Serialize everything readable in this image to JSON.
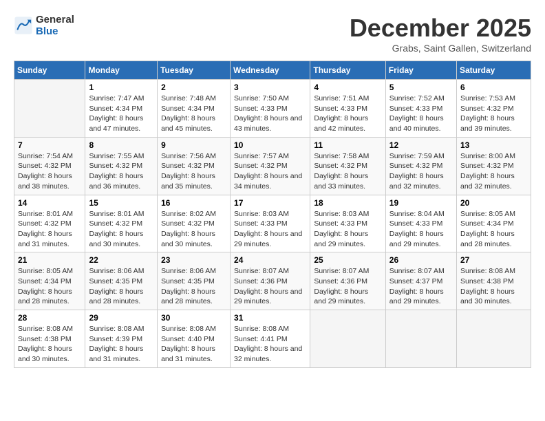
{
  "logo": {
    "line1": "General",
    "line2": "Blue"
  },
  "title": "December 2025",
  "subtitle": "Grabs, Saint Gallen, Switzerland",
  "days_of_week": [
    "Sunday",
    "Monday",
    "Tuesday",
    "Wednesday",
    "Thursday",
    "Friday",
    "Saturday"
  ],
  "weeks": [
    [
      {
        "day": "",
        "sunrise": "",
        "sunset": "",
        "daylight": ""
      },
      {
        "day": "1",
        "sunrise": "Sunrise: 7:47 AM",
        "sunset": "Sunset: 4:34 PM",
        "daylight": "Daylight: 8 hours and 47 minutes."
      },
      {
        "day": "2",
        "sunrise": "Sunrise: 7:48 AM",
        "sunset": "Sunset: 4:34 PM",
        "daylight": "Daylight: 8 hours and 45 minutes."
      },
      {
        "day": "3",
        "sunrise": "Sunrise: 7:50 AM",
        "sunset": "Sunset: 4:33 PM",
        "daylight": "Daylight: 8 hours and 43 minutes."
      },
      {
        "day": "4",
        "sunrise": "Sunrise: 7:51 AM",
        "sunset": "Sunset: 4:33 PM",
        "daylight": "Daylight: 8 hours and 42 minutes."
      },
      {
        "day": "5",
        "sunrise": "Sunrise: 7:52 AM",
        "sunset": "Sunset: 4:33 PM",
        "daylight": "Daylight: 8 hours and 40 minutes."
      },
      {
        "day": "6",
        "sunrise": "Sunrise: 7:53 AM",
        "sunset": "Sunset: 4:32 PM",
        "daylight": "Daylight: 8 hours and 39 minutes."
      }
    ],
    [
      {
        "day": "7",
        "sunrise": "Sunrise: 7:54 AM",
        "sunset": "Sunset: 4:32 PM",
        "daylight": "Daylight: 8 hours and 38 minutes."
      },
      {
        "day": "8",
        "sunrise": "Sunrise: 7:55 AM",
        "sunset": "Sunset: 4:32 PM",
        "daylight": "Daylight: 8 hours and 36 minutes."
      },
      {
        "day": "9",
        "sunrise": "Sunrise: 7:56 AM",
        "sunset": "Sunset: 4:32 PM",
        "daylight": "Daylight: 8 hours and 35 minutes."
      },
      {
        "day": "10",
        "sunrise": "Sunrise: 7:57 AM",
        "sunset": "Sunset: 4:32 PM",
        "daylight": "Daylight: 8 hours and 34 minutes."
      },
      {
        "day": "11",
        "sunrise": "Sunrise: 7:58 AM",
        "sunset": "Sunset: 4:32 PM",
        "daylight": "Daylight: 8 hours and 33 minutes."
      },
      {
        "day": "12",
        "sunrise": "Sunrise: 7:59 AM",
        "sunset": "Sunset: 4:32 PM",
        "daylight": "Daylight: 8 hours and 32 minutes."
      },
      {
        "day": "13",
        "sunrise": "Sunrise: 8:00 AM",
        "sunset": "Sunset: 4:32 PM",
        "daylight": "Daylight: 8 hours and 32 minutes."
      }
    ],
    [
      {
        "day": "14",
        "sunrise": "Sunrise: 8:01 AM",
        "sunset": "Sunset: 4:32 PM",
        "daylight": "Daylight: 8 hours and 31 minutes."
      },
      {
        "day": "15",
        "sunrise": "Sunrise: 8:01 AM",
        "sunset": "Sunset: 4:32 PM",
        "daylight": "Daylight: 8 hours and 30 minutes."
      },
      {
        "day": "16",
        "sunrise": "Sunrise: 8:02 AM",
        "sunset": "Sunset: 4:32 PM",
        "daylight": "Daylight: 8 hours and 30 minutes."
      },
      {
        "day": "17",
        "sunrise": "Sunrise: 8:03 AM",
        "sunset": "Sunset: 4:33 PM",
        "daylight": "Daylight: 8 hours and 29 minutes."
      },
      {
        "day": "18",
        "sunrise": "Sunrise: 8:03 AM",
        "sunset": "Sunset: 4:33 PM",
        "daylight": "Daylight: 8 hours and 29 minutes."
      },
      {
        "day": "19",
        "sunrise": "Sunrise: 8:04 AM",
        "sunset": "Sunset: 4:33 PM",
        "daylight": "Daylight: 8 hours and 29 minutes."
      },
      {
        "day": "20",
        "sunrise": "Sunrise: 8:05 AM",
        "sunset": "Sunset: 4:34 PM",
        "daylight": "Daylight: 8 hours and 28 minutes."
      }
    ],
    [
      {
        "day": "21",
        "sunrise": "Sunrise: 8:05 AM",
        "sunset": "Sunset: 4:34 PM",
        "daylight": "Daylight: 8 hours and 28 minutes."
      },
      {
        "day": "22",
        "sunrise": "Sunrise: 8:06 AM",
        "sunset": "Sunset: 4:35 PM",
        "daylight": "Daylight: 8 hours and 28 minutes."
      },
      {
        "day": "23",
        "sunrise": "Sunrise: 8:06 AM",
        "sunset": "Sunset: 4:35 PM",
        "daylight": "Daylight: 8 hours and 28 minutes."
      },
      {
        "day": "24",
        "sunrise": "Sunrise: 8:07 AM",
        "sunset": "Sunset: 4:36 PM",
        "daylight": "Daylight: 8 hours and 29 minutes."
      },
      {
        "day": "25",
        "sunrise": "Sunrise: 8:07 AM",
        "sunset": "Sunset: 4:36 PM",
        "daylight": "Daylight: 8 hours and 29 minutes."
      },
      {
        "day": "26",
        "sunrise": "Sunrise: 8:07 AM",
        "sunset": "Sunset: 4:37 PM",
        "daylight": "Daylight: 8 hours and 29 minutes."
      },
      {
        "day": "27",
        "sunrise": "Sunrise: 8:08 AM",
        "sunset": "Sunset: 4:38 PM",
        "daylight": "Daylight: 8 hours and 30 minutes."
      }
    ],
    [
      {
        "day": "28",
        "sunrise": "Sunrise: 8:08 AM",
        "sunset": "Sunset: 4:38 PM",
        "daylight": "Daylight: 8 hours and 30 minutes."
      },
      {
        "day": "29",
        "sunrise": "Sunrise: 8:08 AM",
        "sunset": "Sunset: 4:39 PM",
        "daylight": "Daylight: 8 hours and 31 minutes."
      },
      {
        "day": "30",
        "sunrise": "Sunrise: 8:08 AM",
        "sunset": "Sunset: 4:40 PM",
        "daylight": "Daylight: 8 hours and 31 minutes."
      },
      {
        "day": "31",
        "sunrise": "Sunrise: 8:08 AM",
        "sunset": "Sunset: 4:41 PM",
        "daylight": "Daylight: 8 hours and 32 minutes."
      },
      {
        "day": "",
        "sunrise": "",
        "sunset": "",
        "daylight": ""
      },
      {
        "day": "",
        "sunrise": "",
        "sunset": "",
        "daylight": ""
      },
      {
        "day": "",
        "sunrise": "",
        "sunset": "",
        "daylight": ""
      }
    ]
  ]
}
